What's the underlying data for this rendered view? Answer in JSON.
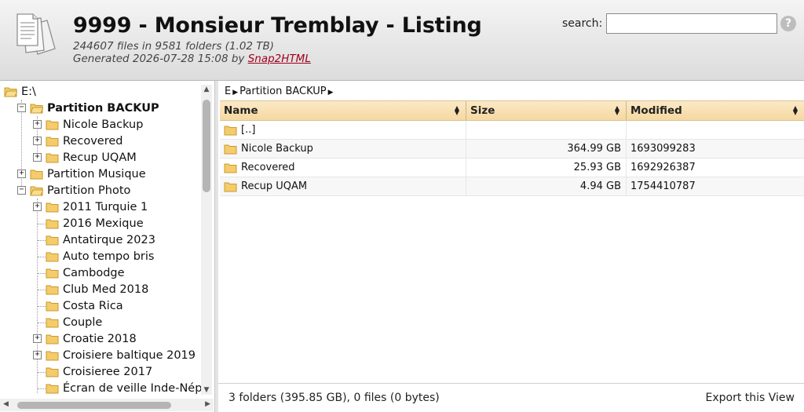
{
  "header": {
    "title": "9999 - Monsieur Tremblay - Listing",
    "stats": "244607 files in 9581 folders (1.02 TB)",
    "generated_prefix": "Generated 2026-07-28 15:08 by ",
    "generator_link": "Snap2HTML",
    "search_label": "search:",
    "search_value": "",
    "help_label": "?"
  },
  "tree": {
    "root": "E:\\",
    "items": [
      {
        "label": "Partition BACKUP",
        "toggle": "−"
      },
      {
        "label": "Nicole Backup",
        "toggle": "+"
      },
      {
        "label": "Recovered",
        "toggle": "+"
      },
      {
        "label": "Recup UQAM",
        "toggle": "+"
      },
      {
        "label": "Partition Musique",
        "toggle": "+"
      },
      {
        "label": "Partition Photo",
        "toggle": "−"
      },
      {
        "label": "2011 Turquie 1",
        "toggle": "+"
      },
      {
        "label": "2016 Mexique",
        "toggle": ""
      },
      {
        "label": "Antatirque 2023",
        "toggle": ""
      },
      {
        "label": "Auto tempo bris",
        "toggle": ""
      },
      {
        "label": "Cambodge",
        "toggle": ""
      },
      {
        "label": "Club Med 2018",
        "toggle": ""
      },
      {
        "label": "Costa Rica",
        "toggle": ""
      },
      {
        "label": "Couple",
        "toggle": ""
      },
      {
        "label": "Croatie 2018",
        "toggle": "+"
      },
      {
        "label": "Croisiere baltique 2019",
        "toggle": "+"
      },
      {
        "label": "Croisieree 2017",
        "toggle": ""
      },
      {
        "label": "Écran de veille Inde-Nép",
        "toggle": ""
      }
    ]
  },
  "breadcrumb": {
    "segments": [
      "E",
      "Partition BACKUP"
    ],
    "sep": "▶"
  },
  "grid": {
    "columns": [
      "Name",
      "Size",
      "Modified"
    ],
    "sort_icon": "▲▼",
    "parent_label": "[..]",
    "rows": [
      {
        "name": "Nicole Backup",
        "size": "364.99 GB",
        "modified": "1693099283"
      },
      {
        "name": "Recovered",
        "size": "25.93 GB",
        "modified": "1692926387"
      },
      {
        "name": "Recup UQAM",
        "size": "4.94 GB",
        "modified": "1754410787"
      }
    ]
  },
  "status": {
    "summary": "3 folders (395.85 GB), 0 files (0 bytes)",
    "export_label": "Export this View"
  },
  "colors": {
    "header_grid": "#f6d8a1",
    "folder": "#f5cc6b",
    "link": "#a0001e"
  },
  "icons": {
    "logo": "documents-icon",
    "folder": "folder-icon",
    "help": "help-icon",
    "sort": "sort-icon"
  }
}
